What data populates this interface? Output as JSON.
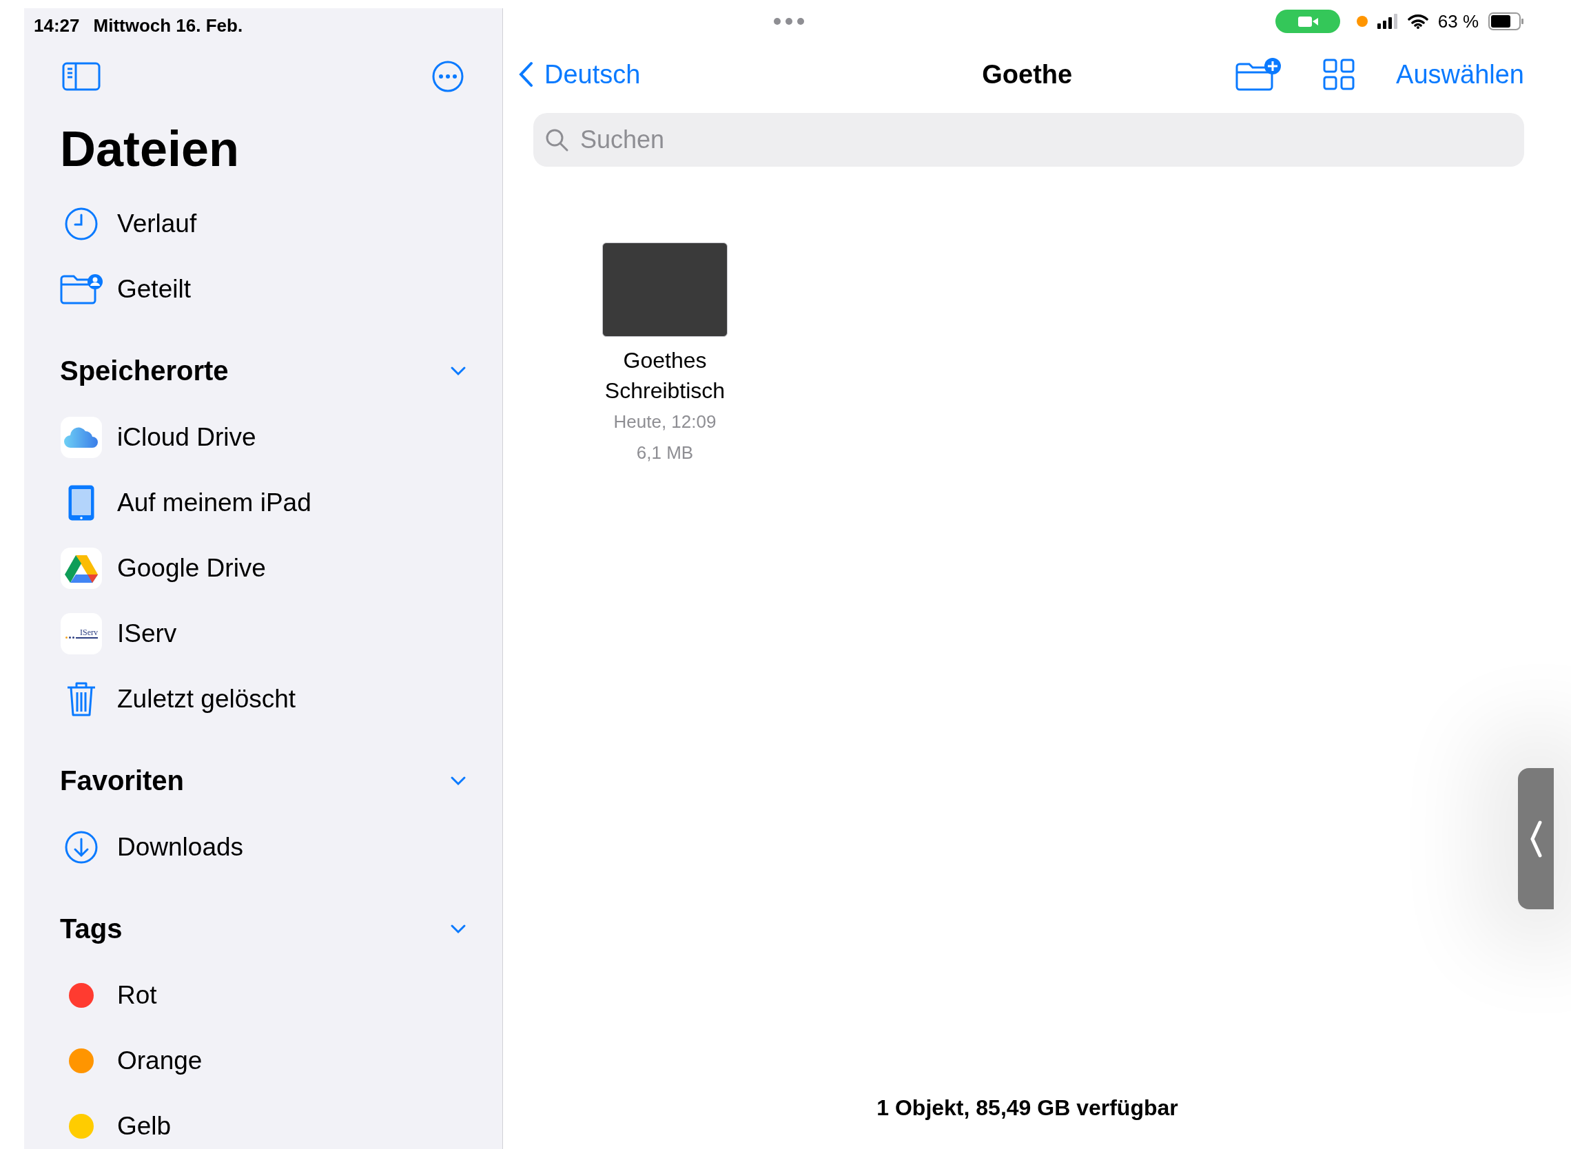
{
  "status_bar": {
    "time": "14:27",
    "date": "Mittwoch 16. Feb.",
    "battery": "63 %"
  },
  "sidebar": {
    "title": "Dateien",
    "top_items": [
      {
        "label": "Verlauf",
        "kind": "clock"
      },
      {
        "label": "Geteilt",
        "kind": "shared"
      }
    ],
    "sections": [
      {
        "title": "Speicherorte",
        "expanded": true,
        "items": [
          {
            "label": "iCloud Drive",
            "kind": "icloud"
          },
          {
            "label": "Auf meinem iPad",
            "kind": "ipad"
          },
          {
            "label": "Google Drive",
            "kind": "gdrive"
          },
          {
            "label": "IServ",
            "kind": "iserv",
            "logo_text": "IServ"
          },
          {
            "label": "Zuletzt gelöscht",
            "kind": "trash"
          }
        ]
      },
      {
        "title": "Favoriten",
        "expanded": true,
        "items": [
          {
            "label": "Downloads",
            "kind": "download"
          }
        ]
      },
      {
        "title": "Tags",
        "expanded": true,
        "items": [
          {
            "label": "Rot",
            "kind": "tag",
            "color": "#ff3b30"
          },
          {
            "label": "Orange",
            "kind": "tag",
            "color": "#ff9500"
          },
          {
            "label": "Gelb",
            "kind": "tag",
            "color": "#ffcc00"
          }
        ]
      }
    ]
  },
  "nav": {
    "back": "Deutsch",
    "title": "Goethe",
    "select": "Auswählen"
  },
  "search": {
    "placeholder": "Suchen"
  },
  "files": [
    {
      "name": "Goethes Schreibtisch",
      "date": "Heute, 12:09",
      "size": "6,1 MB"
    }
  ],
  "footer": "1 Objekt, 85,49 GB verfügbar"
}
